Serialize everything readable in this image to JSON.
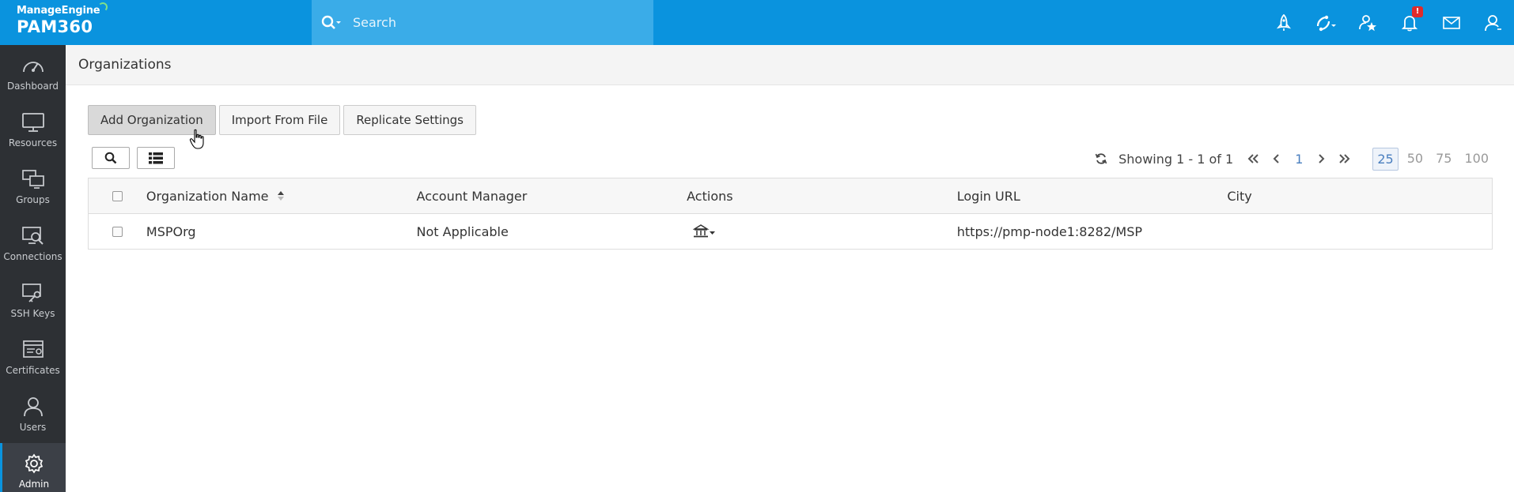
{
  "brand": {
    "vendor": "ManageEngine",
    "product": "PAM360"
  },
  "search": {
    "placeholder": "Search"
  },
  "topbar": {
    "icons": [
      "rocket-icon",
      "connections-menu-icon",
      "star-user-icon",
      "bell-icon",
      "mail-icon",
      "user-icon"
    ],
    "notification_badge": "!"
  },
  "sidebar": {
    "items": [
      {
        "label": "Dashboard",
        "icon": "gauge-icon"
      },
      {
        "label": "Resources",
        "icon": "monitor-icon"
      },
      {
        "label": "Groups",
        "icon": "groups-icon"
      },
      {
        "label": "Connections",
        "icon": "connections-icon"
      },
      {
        "label": "SSH Keys",
        "icon": "ssh-key-icon"
      },
      {
        "label": "Certificates",
        "icon": "certificate-icon"
      },
      {
        "label": "Users",
        "icon": "user-icon"
      },
      {
        "label": "Admin",
        "icon": "gear-icon",
        "active": true
      }
    ]
  },
  "page": {
    "title": "Organizations"
  },
  "toolbar": {
    "add_label": "Add Organization",
    "import_label": "Import From File",
    "replicate_label": "Replicate Settings"
  },
  "pager": {
    "showing": "Showing 1 - 1 of 1",
    "current_page": "1",
    "sizes": [
      "25",
      "50",
      "75",
      "100"
    ],
    "selected_size": "25"
  },
  "table": {
    "columns": [
      "Organization Name",
      "Account Manager",
      "Actions",
      "Login URL",
      "City"
    ],
    "rows": [
      {
        "name": "MSPOrg",
        "account_manager": "Not Applicable",
        "login_url": "https://pmp-node1:8282/MSP",
        "city": ""
      }
    ]
  },
  "colors": {
    "accent": "#0a93de",
    "search_bg": "#3aace8",
    "sidebar_bg": "#2d3034"
  }
}
